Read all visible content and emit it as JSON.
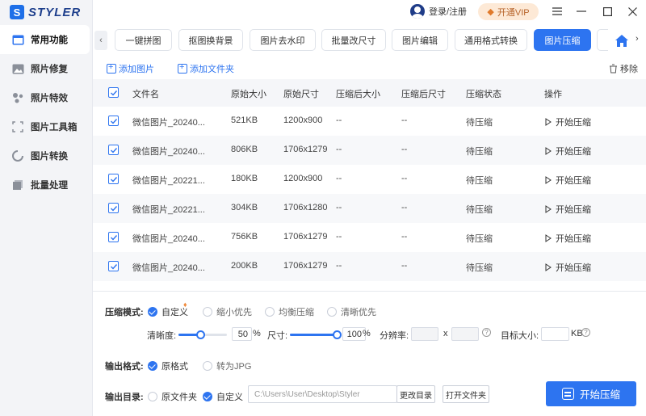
{
  "app": {
    "logo_text": "STYLER",
    "logo_mark": "S"
  },
  "sidebar": {
    "items": [
      {
        "label": "常用功能",
        "icon": "common-features-icon",
        "active": true
      },
      {
        "label": "照片修复",
        "icon": "photo-repair-icon",
        "active": false
      },
      {
        "label": "照片特效",
        "icon": "photo-effects-icon",
        "active": false
      },
      {
        "label": "图片工具箱",
        "icon": "toolbox-icon",
        "active": false
      },
      {
        "label": "图片转换",
        "icon": "convert-icon",
        "active": false
      },
      {
        "label": "批量处理",
        "icon": "batch-icon",
        "active": false
      }
    ]
  },
  "topbar": {
    "login_label": "登录/注册",
    "vip_label": "开通VIP"
  },
  "tabs": [
    {
      "label": "一键拼图",
      "active": false
    },
    {
      "label": "抠图换背景",
      "active": false
    },
    {
      "label": "图片去水印",
      "active": false
    },
    {
      "label": "批量改尺寸",
      "active": false
    },
    {
      "label": "图片编辑",
      "active": false
    },
    {
      "label": "通用格式转换",
      "active": false
    },
    {
      "label": "图片压缩",
      "active": true
    }
  ],
  "actions": {
    "add_image": "添加图片",
    "add_folder": "添加文件夹",
    "remove": "移除"
  },
  "table": {
    "headers": [
      "文件名",
      "原始大小",
      "原始尺寸",
      "压缩后大小",
      "压缩后尺寸",
      "压缩状态",
      "操作"
    ],
    "rows": [
      {
        "name": "微信图片_20240...",
        "size": "521KB",
        "dims": "1200x900",
        "csize": "--",
        "cdims": "--",
        "status": "待压缩",
        "action": "开始压缩"
      },
      {
        "name": "微信图片_20240...",
        "size": "806KB",
        "dims": "1706x1279",
        "csize": "--",
        "cdims": "--",
        "status": "待压缩",
        "action": "开始压缩"
      },
      {
        "name": "微信图片_20221...",
        "size": "180KB",
        "dims": "1200x900",
        "csize": "--",
        "cdims": "--",
        "status": "待压缩",
        "action": "开始压缩"
      },
      {
        "name": "微信图片_20221...",
        "size": "304KB",
        "dims": "1706x1280",
        "csize": "--",
        "cdims": "--",
        "status": "待压缩",
        "action": "开始压缩"
      },
      {
        "name": "微信图片_20240...",
        "size": "756KB",
        "dims": "1706x1279",
        "csize": "--",
        "cdims": "--",
        "status": "待压缩",
        "action": "开始压缩"
      },
      {
        "name": "微信图片_20240...",
        "size": "200KB",
        "dims": "1706x1279",
        "csize": "--",
        "cdims": "--",
        "status": "待压缩",
        "action": "开始压缩"
      }
    ]
  },
  "settings": {
    "mode_label": "压缩模式:",
    "modes": [
      "自定义",
      "缩小优先",
      "均衡压缩",
      "清晰优先"
    ],
    "clarity_label": "清晰度:",
    "clarity_value": "50",
    "clarity_unit": "%",
    "size_label": "尺寸:",
    "size_value": "100",
    "size_unit": "%",
    "resolution_label": "分辨率:",
    "resolution_x": "x",
    "target_label": "目标大小:",
    "target_unit": "KB",
    "format_label": "输出格式:",
    "formats": [
      "原格式",
      "转为JPG"
    ],
    "dir_label": "输出目录:",
    "dirs": [
      "原文件夹",
      "自定义"
    ],
    "path": "C:\\Users\\User\\Desktop\\Styler",
    "change_dir": "更改目录",
    "open_folder": "打开文件夹",
    "start_button": "开始压缩"
  },
  "colors": {
    "accent": "#2d74f0",
    "vip_bg": "#fde9d6"
  }
}
